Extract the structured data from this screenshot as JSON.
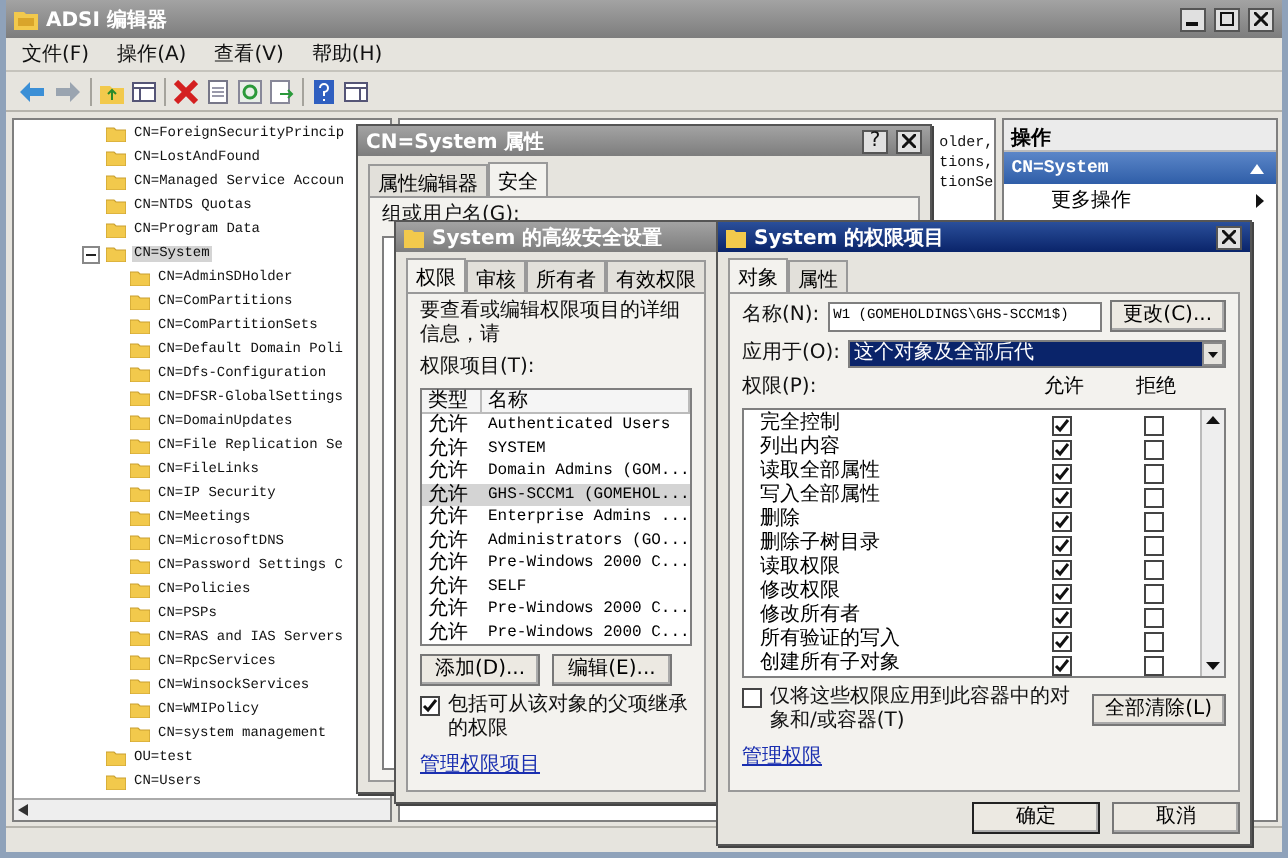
{
  "window": {
    "title": "ADSI 编辑器",
    "active": false
  },
  "menu": [
    {
      "label": "文件(F)"
    },
    {
      "label": "操作(A)"
    },
    {
      "label": "查看(V)"
    },
    {
      "label": "帮助(H)"
    }
  ],
  "tree": {
    "items": [
      {
        "label": "CN=ForeignSecurityPrincip",
        "selected": false,
        "expanded": false
      },
      {
        "label": "CN=LostAndFound",
        "selected": false,
        "expanded": false
      },
      {
        "label": "CN=Managed Service Accoun",
        "selected": false,
        "expanded": false
      },
      {
        "label": "CN=NTDS Quotas",
        "selected": false,
        "expanded": false
      },
      {
        "label": "CN=Program Data",
        "selected": false,
        "expanded": false
      },
      {
        "label": "CN=System",
        "selected": true,
        "expanded": true,
        "children": [
          {
            "label": "CN=AdminSDHolder",
            "selected": false
          },
          {
            "label": "CN=ComPartitions",
            "selected": false
          },
          {
            "label": "CN=ComPartitionSets",
            "selected": false
          },
          {
            "label": "CN=Default Domain Poli",
            "selected": false
          },
          {
            "label": "CN=Dfs-Configuration",
            "selected": false
          },
          {
            "label": "CN=DFSR-GlobalSettings",
            "selected": false
          },
          {
            "label": "CN=DomainUpdates",
            "selected": false
          },
          {
            "label": "CN=File Replication Se",
            "selected": false
          },
          {
            "label": "CN=FileLinks",
            "selected": false
          },
          {
            "label": "CN=IP Security",
            "selected": false
          },
          {
            "label": "CN=Meetings",
            "selected": false
          },
          {
            "label": "CN=MicrosoftDNS",
            "selected": false
          },
          {
            "label": "CN=Password Settings C",
            "selected": false
          },
          {
            "label": "CN=Policies",
            "selected": false
          },
          {
            "label": "CN=PSPs",
            "selected": false
          },
          {
            "label": "CN=RAS and IAS Servers",
            "selected": false
          },
          {
            "label": "CN=RpcServices",
            "selected": false
          },
          {
            "label": "CN=WinsockServices",
            "selected": false
          },
          {
            "label": "CN=WMIPolicy",
            "selected": false
          },
          {
            "label": "CN=system management",
            "selected": false
          }
        ]
      },
      {
        "label": "OU=test",
        "selected": false,
        "expanded": false
      },
      {
        "label": "CN=Users",
        "selected": false,
        "expanded": false
      }
    ]
  },
  "list_pane": {
    "cells": [
      "older,",
      "tions,",
      "tionSe"
    ]
  },
  "actions_pane": {
    "title": "操作",
    "section": "CN=System",
    "items": [
      "更多操作"
    ]
  },
  "properties_dialog": {
    "title": "CN=System 属性",
    "active": false,
    "help_button": "?",
    "tabs": [
      {
        "label": "属性编辑器",
        "selected": false
      },
      {
        "label": "安全",
        "selected": true
      }
    ],
    "group_label": "组或用户名(G):"
  },
  "advanced_dialog": {
    "title": "System 的高级安全设置",
    "active": false,
    "tabs": [
      {
        "label": "权限",
        "selected": true
      },
      {
        "label": "审核",
        "selected": false
      },
      {
        "label": "所有者",
        "selected": false
      },
      {
        "label": "有效权限",
        "selected": false
      }
    ],
    "intro": "要查看或编辑权限项目的详细信息，请",
    "list_label": "权限项目(T):",
    "columns": [
      "类型",
      "名称"
    ],
    "rows": [
      {
        "type": "允许",
        "name": "Authenticated Users",
        "selected": false
      },
      {
        "type": "允许",
        "name": "SYSTEM",
        "selected": false
      },
      {
        "type": "允许",
        "name": "Domain Admins (GOM...",
        "selected": false
      },
      {
        "type": "允许",
        "name": "GHS-SCCM1 (GOMEHOL...",
        "selected": true
      },
      {
        "type": "允许",
        "name": "Enterprise Admins ...",
        "selected": false
      },
      {
        "type": "允许",
        "name": "Administrators (GO...",
        "selected": false
      },
      {
        "type": "允许",
        "name": "Pre-Windows 2000 C...",
        "selected": false
      },
      {
        "type": "允许",
        "name": "SELF",
        "selected": false
      },
      {
        "type": "允许",
        "name": "Pre-Windows 2000 C...",
        "selected": false
      },
      {
        "type": "允许",
        "name": "Pre-Windows 2000 C...",
        "selected": false
      }
    ],
    "buttons": [
      "添加(D)...",
      "编辑(E)..."
    ],
    "inherit": {
      "label": "包括可从该对象的父项继承的权限",
      "checked": true
    },
    "link": "管理权限项目"
  },
  "entry_dialog": {
    "title": "System 的权限项目",
    "active": true,
    "tabs": [
      {
        "label": "对象",
        "selected": true
      },
      {
        "label": "属性",
        "selected": false
      }
    ],
    "name_label": "名称(N):",
    "name_value": "W1 (GOMEHOLDINGS\\GHS-SCCM1$)",
    "change_button": "更改(C)...",
    "apply_label": "应用于(O):",
    "apply_value": "这个对象及全部后代",
    "permissions_label": "权限(P):",
    "columns": [
      "允许",
      "拒绝"
    ],
    "permissions": [
      {
        "name": "完全控制",
        "allow": true,
        "deny": false
      },
      {
        "name": "列出内容",
        "allow": true,
        "deny": false
      },
      {
        "name": "读取全部属性",
        "allow": true,
        "deny": false
      },
      {
        "name": "写入全部属性",
        "allow": true,
        "deny": false
      },
      {
        "name": "删除",
        "allow": true,
        "deny": false
      },
      {
        "name": "删除子树目录",
        "allow": true,
        "deny": false
      },
      {
        "name": "读取权限",
        "allow": true,
        "deny": false
      },
      {
        "name": "修改权限",
        "allow": true,
        "deny": false
      },
      {
        "name": "修改所有者",
        "allow": true,
        "deny": false
      },
      {
        "name": "所有验证的写入",
        "allow": true,
        "deny": false
      },
      {
        "name": "创建所有子对象",
        "allow": true,
        "deny": false
      }
    ],
    "only_apply": {
      "label": "仅将这些权限应用到此容器中的对象和/或容器(T)",
      "checked": false
    },
    "clear_button": "全部清除(L)",
    "link": "管理权限",
    "buttons": [
      "确定",
      "取消"
    ]
  }
}
